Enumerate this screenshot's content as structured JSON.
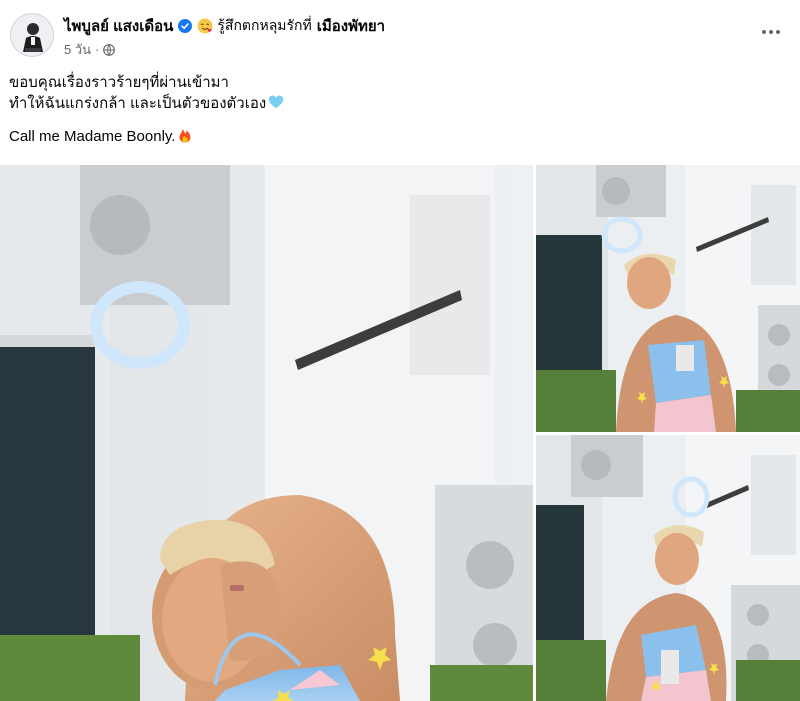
{
  "post": {
    "author": "ไพบูลย์ แสงเดือน",
    "feeling_text": "รู้สึกตกหลุมรักที่",
    "location": "เมืองพัทยา",
    "timestamp": "5 วัน",
    "dot": "·",
    "lines": [
      "ขอบคุณเรื่องราวร้ายๆที่ผ่านเข้ามา",
      "ทำให้ฉันแกร่งกล้า และเป็นตัวของตัวเอง"
    ],
    "tagline": "Call me Madame Boonly."
  },
  "icons": {
    "verified": "verified-badge-icon",
    "feeling": "in-love-face-emoji",
    "privacy": "globe-icon",
    "more": "more-options-icon",
    "heart": "light-blue-heart-emoji",
    "fire": "fire-emoji"
  },
  "colors": {
    "verified_blue": "#1877f2",
    "meta_gray": "#65676b",
    "text": "#050505"
  }
}
